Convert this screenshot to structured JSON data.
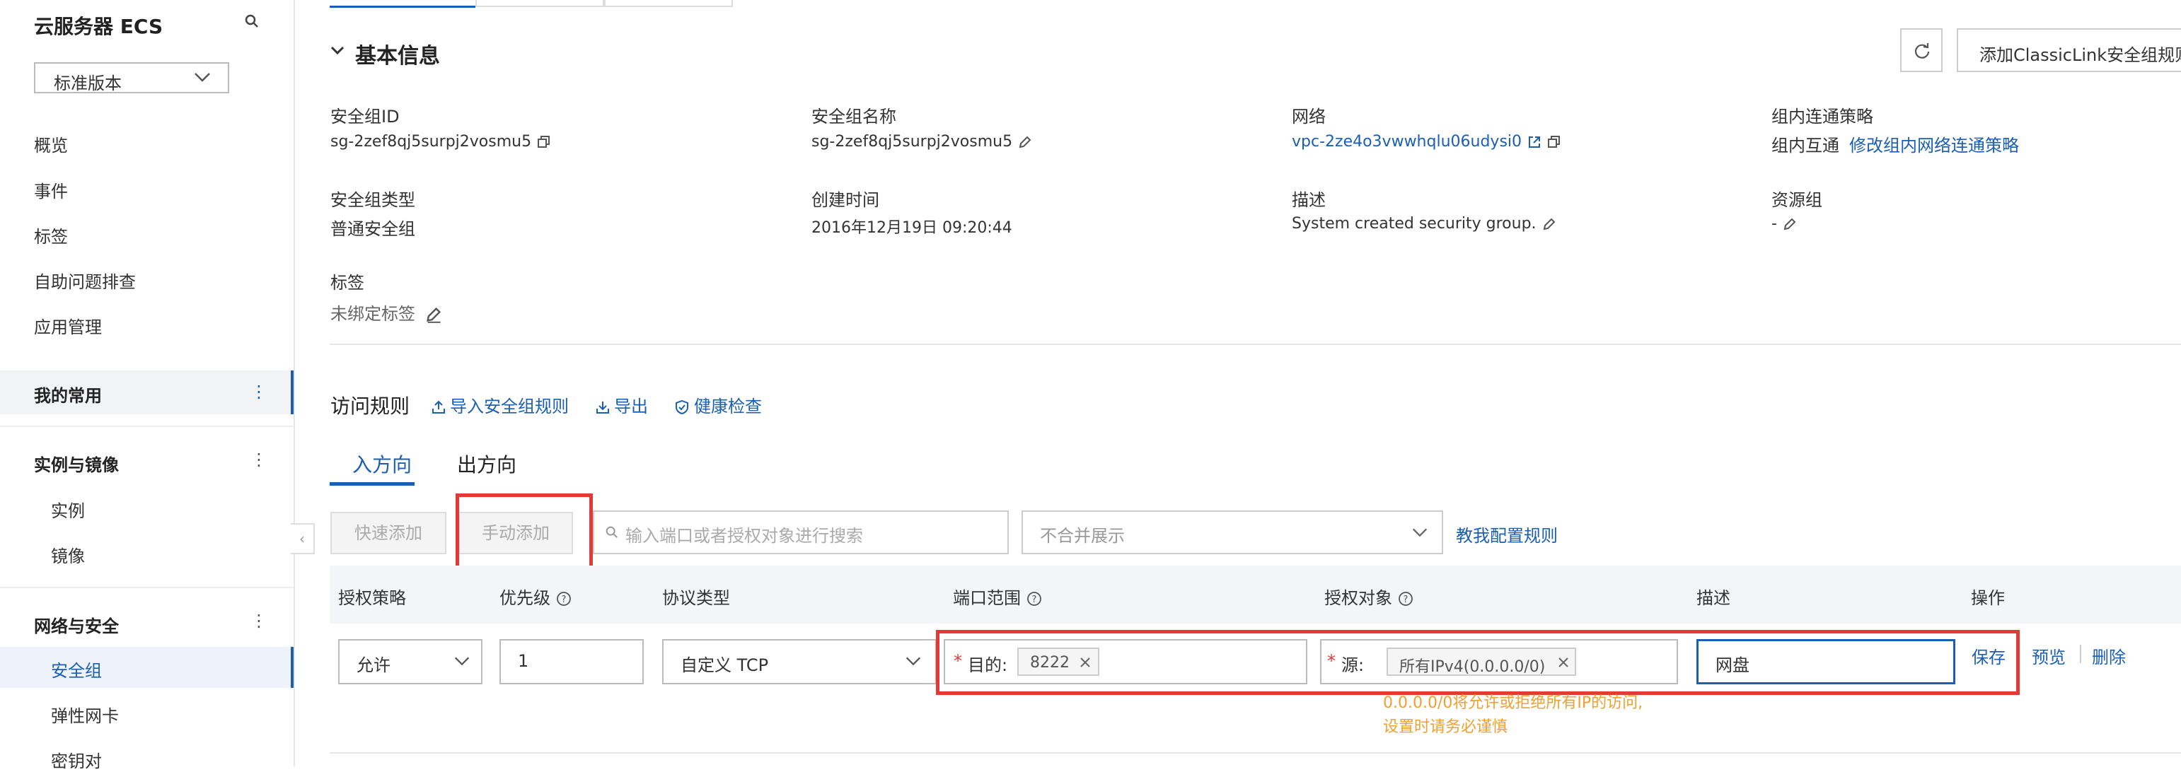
{
  "sidebar": {
    "title": "云服务器 ECS",
    "version_select": "标准版本",
    "top_items": [
      "概览",
      "事件",
      "标签",
      "自助问题排查",
      "应用管理"
    ],
    "groups": [
      {
        "title": "我的常用",
        "items": []
      },
      {
        "title": "实例与镜像",
        "items": [
          "实例",
          "镜像"
        ]
      },
      {
        "title": "网络与安全",
        "items": [
          "安全组",
          "弹性网卡",
          "密钥对"
        ]
      }
    ],
    "active_item": "安全组"
  },
  "basic_info": {
    "section_title": "基本信息",
    "refresh_button": "refresh",
    "add_classiclink_button": "添加ClassicLink安全组规则",
    "fields": {
      "sg_id_label": "安全组ID",
      "sg_id": "sg-2zef8qj5surpj2vosmu5",
      "sg_name_label": "安全组名称",
      "sg_name": "sg-2zef8qj5surpj2vosmu5",
      "network_label": "网络",
      "network": "vpc-2ze4o3vwwhqlu06udysi0",
      "policy_label": "组内连通策略",
      "policy": "组内互通",
      "policy_link": "修改组内网络连通策略",
      "sg_type_label": "安全组类型",
      "sg_type": "普通安全组",
      "created_label": "创建时间",
      "created": "2016年12月19日 09:20:44",
      "desc_label": "描述",
      "desc": "System created security group.",
      "rg_label": "资源组",
      "rg": "-",
      "tags_label": "标签",
      "tags": "未绑定标签"
    }
  },
  "access_rules": {
    "title": "访问规则",
    "import_link": "导入安全组规则",
    "export_link": "导出",
    "health_link": "健康检查",
    "tabs": [
      "入方向",
      "出方向"
    ],
    "active_tab": "入方向",
    "quick_add": "快速添加",
    "manual_add": "手动添加",
    "search_placeholder": "输入端口或者授权对象进行搜索",
    "merge_select": "不合并展示",
    "teach_link": "教我配置规则",
    "columns": [
      "授权策略",
      "优先级",
      "协议类型",
      "端口范围",
      "授权对象",
      "描述",
      "操作"
    ],
    "row": {
      "policy": "允许",
      "priority": "1",
      "protocol": "自定义 TCP",
      "port_prefix": "目的:",
      "port_tag": "8222",
      "source_prefix": "源:",
      "source_tag": "所有IPv4(0.0.0.0/0)",
      "description": "网盘",
      "actions": [
        "保存",
        "预览",
        "删除"
      ],
      "warning": [
        "0.0.0.0/0将允许或拒绝所有IP的访问,",
        "设置时请务必谨慎"
      ]
    }
  },
  "colors": {
    "accent": "#1a5fb4",
    "highlight": "#e53935",
    "warning": "#f0a030"
  }
}
